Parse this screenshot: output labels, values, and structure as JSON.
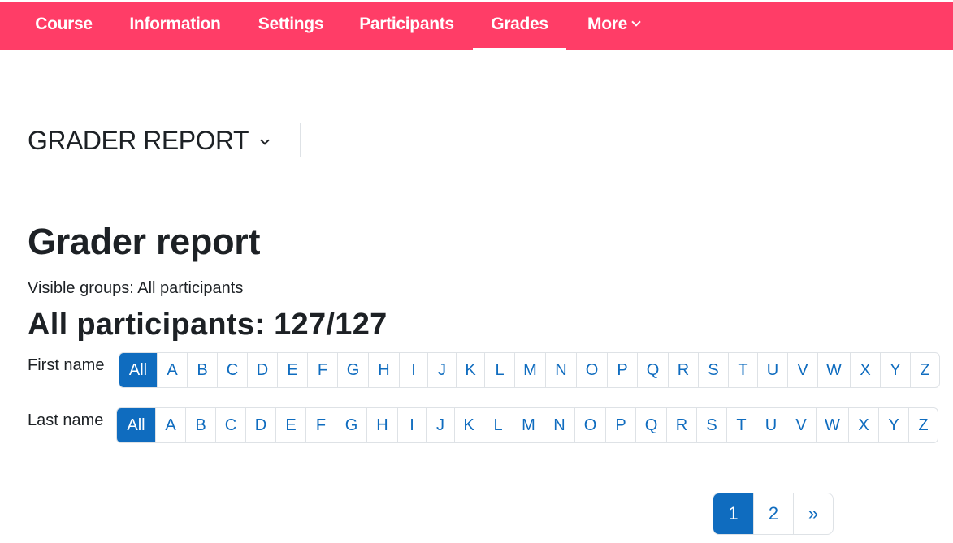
{
  "nav": {
    "items": [
      {
        "label": "Course"
      },
      {
        "label": "Information"
      },
      {
        "label": "Settings"
      },
      {
        "label": "Participants"
      },
      {
        "label": "Grades",
        "active": true
      },
      {
        "label": "More"
      }
    ]
  },
  "report_selector": {
    "label": "GRADER REPORT"
  },
  "page": {
    "title": "Grader report",
    "groups_text": "Visible groups: All participants",
    "count_title": "All participants: 127/127"
  },
  "filters": {
    "first_name_label": "First name",
    "last_name_label": "Last name",
    "all_label": "All",
    "letters": [
      "A",
      "B",
      "C",
      "D",
      "E",
      "F",
      "G",
      "H",
      "I",
      "J",
      "K",
      "L",
      "M",
      "N",
      "O",
      "P",
      "Q",
      "R",
      "S",
      "T",
      "U",
      "V",
      "W",
      "X",
      "Y",
      "Z"
    ],
    "first_name_selected": "All",
    "last_name_selected": "All"
  },
  "pagination": {
    "pages": [
      "1",
      "2"
    ],
    "current": "1",
    "next_label": "»"
  },
  "colors": {
    "nav_background": "#ff3d67",
    "primary": "#0f6cbf",
    "text": "#1d2125",
    "border": "#dee2e6"
  }
}
